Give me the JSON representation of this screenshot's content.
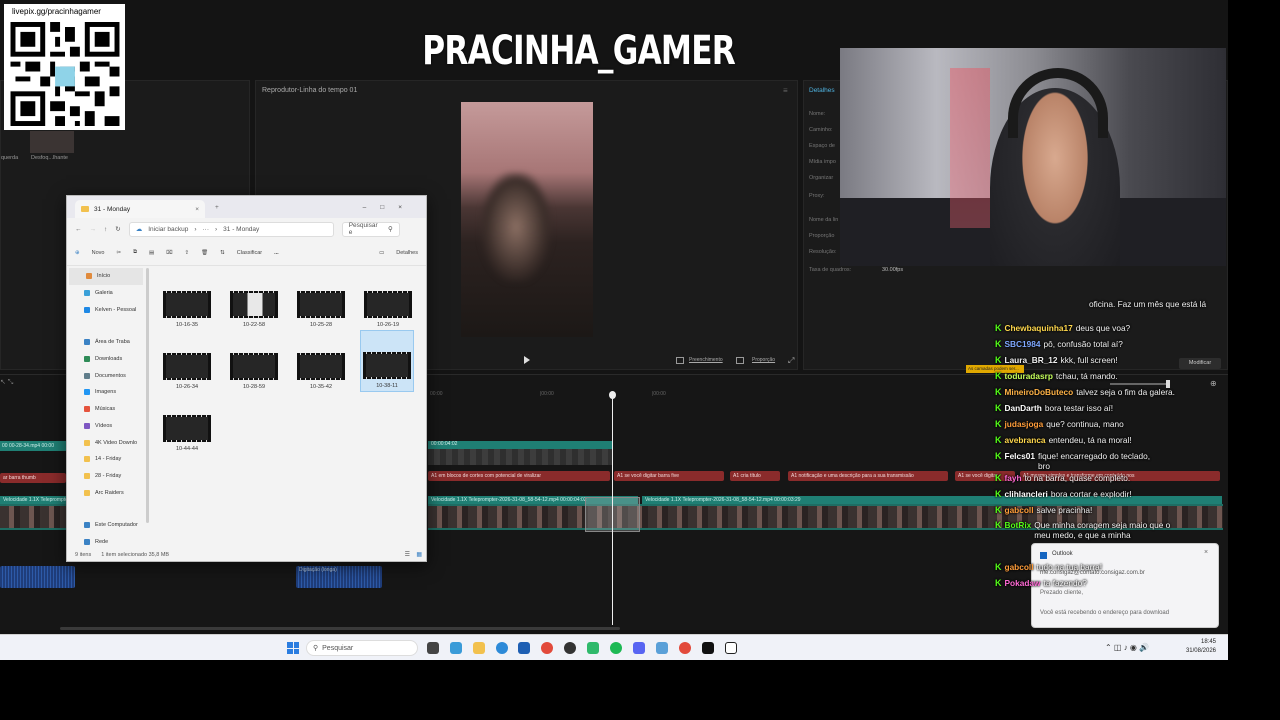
{
  "qr": {
    "url_label": "livepix.gg/pracinhagamer"
  },
  "stream": {
    "title": "PRACINHA_GAMER"
  },
  "editor": {
    "media_labels": [
      "querda",
      "Desfoq...lhante"
    ],
    "player_title": "Reprodutor-Linha do tempo 01",
    "player_buttons": [
      "Preenchimento",
      "Proporção"
    ],
    "details_title": "Detalhes",
    "detail_labels": [
      "Nome:",
      "Caminho:",
      "Espaço de",
      "Mídia impo",
      "Organizar",
      "Proxy:",
      "Nome da lin",
      "Proporção",
      "Resolução:",
      "Taxa de quadros:"
    ],
    "frame_rate": "30.00fps",
    "modify_button": "Modificar",
    "layers_tooltip": "As camadas podem ser..."
  },
  "timeline": {
    "ruler": [
      "00:00",
      "|00:00",
      "|00:00"
    ],
    "clip_label_top": "00:00:04:02",
    "left_clip_label": "00 00-28-34.mp4  00:00",
    "left_text_clip": "ar barra thumb",
    "left_teal_clip": "Velocidade 1.1X  Teleprompter",
    "red_clips": [
      "A1 em blocos de cortes com potencial de viralizar",
      "A1 se você digitar barra five",
      "A1 cria título",
      "A1 notificação e uma descrição para a sua transmissão",
      "A1 se você digitar",
      "A1 mesmo simples e transforme em conteúdo nos"
    ],
    "teal_clips": [
      "Velocidade 1.1X  Teleprompter-2026-31-08_58-54-12.mp4  00:00:04:02",
      "Velocidade 1.1X  Teleprompter-2026-31-08_58-54-12.mp4  00:00:03:29"
    ],
    "audio_label": "Digitação (longa)"
  },
  "explorer": {
    "tab_title": "31 - Monday",
    "backup_label": "Iniciar backup",
    "path": "31 - Monday",
    "search_placeholder": "Pesquisar e",
    "toolbar": {
      "new": "Novo",
      "sort": "Classificar",
      "more": "...",
      "details": "Detalhes"
    },
    "nav": [
      {
        "label": "Início",
        "color": "#e08a3c"
      },
      {
        "label": "Galeria",
        "color": "#3aa0d8"
      },
      {
        "label": "Kelven - Pessoal",
        "color": "#1e88e5"
      },
      {
        "label": "Área de Traba",
        "color": "#3b82c4"
      },
      {
        "label": "Downloads",
        "color": "#2e8b57"
      },
      {
        "label": "Documentos",
        "color": "#607d8b"
      },
      {
        "label": "Imagens",
        "color": "#2196f3"
      },
      {
        "label": "Músicas",
        "color": "#e5533d"
      },
      {
        "label": "Vídeos",
        "color": "#7e57c2"
      },
      {
        "label": "4K Video Downlo",
        "color": "#f2c14e"
      },
      {
        "label": "14 - Friday",
        "color": "#f2c14e"
      },
      {
        "label": "28 - Friday",
        "color": "#f2c14e"
      },
      {
        "label": "Arc Raiders",
        "color": "#f2c14e"
      },
      {
        "label": "Este Computador",
        "color": "#3b82c4"
      },
      {
        "label": "Rede",
        "color": "#3b82c4"
      }
    ],
    "files": [
      "10-16-35",
      "10-22-58",
      "10-25-28",
      "10-26-19",
      "10-26-34",
      "10-28-59",
      "10-35-42",
      "10-38-11",
      "10-44-44"
    ],
    "status": {
      "count": "9 itens",
      "selected": "1 item selecionado  35,8 MB"
    }
  },
  "chat": [
    {
      "user": "",
      "message": "oficina. Faz um mês que está lá",
      "color": "#ffffff"
    },
    {
      "user": "Chewbaquinha17",
      "message": "deus que voa?",
      "color": "#ffd84d"
    },
    {
      "user": "SBC1984",
      "message": "pô, confusão total aí?",
      "color": "#7fa8ff"
    },
    {
      "user": "Laura_BR_12",
      "message": "kkk, full screen!",
      "color": "#f0f0f0"
    },
    {
      "user": "toduradasrp",
      "message": "tchau, tá mando.",
      "color": "#c5ff5c"
    },
    {
      "user": "MineiroDoButeco",
      "message": "talvez seja o fim da galera.",
      "color": "#ffb347"
    },
    {
      "user": "DanDarth",
      "message": "bora testar isso aí!",
      "color": "#ffffff"
    },
    {
      "user": "judasjoga",
      "message": "que? continua, mano",
      "color": "#ff9d3a"
    },
    {
      "user": "avebranca",
      "message": "entendeu, tá na moral!",
      "color": "#ffd84d"
    },
    {
      "user": "Felcs01",
      "message": "fique! encarregado do teclado, bro",
      "color": "#ffffff"
    },
    {
      "user": "fayh",
      "message": "to na barra, quase completo.",
      "color": "#ff6ad5"
    },
    {
      "user": "clihlancleri",
      "message": "bora cortar e explodir!",
      "color": "#ffffff"
    },
    {
      "user": "gabcoll",
      "message": "salve pracinha!",
      "color": "#ff9d3a"
    },
    {
      "user": "BotRix",
      "message": "Que minha coragem seja maio que o meu medo, e que a minha",
      "color": "#53fc18"
    },
    {
      "user": "gabcoll",
      "message": "tudo na tua barra!",
      "color": "#ff9d3a"
    },
    {
      "user": "Pokadaw",
      "message": "ta fazendo?",
      "color": "#ff6ad5"
    }
  ],
  "notification": {
    "app": "Outlook",
    "sender": "nfe.consigaz@contato.consigaz.com.br",
    "greeting": "Prezado cliente,",
    "body": "Você está recebendo o endereço para download"
  },
  "taskbar": {
    "search_placeholder": "Pesquisar",
    "time": "18:45",
    "date": "31/08/2026"
  }
}
